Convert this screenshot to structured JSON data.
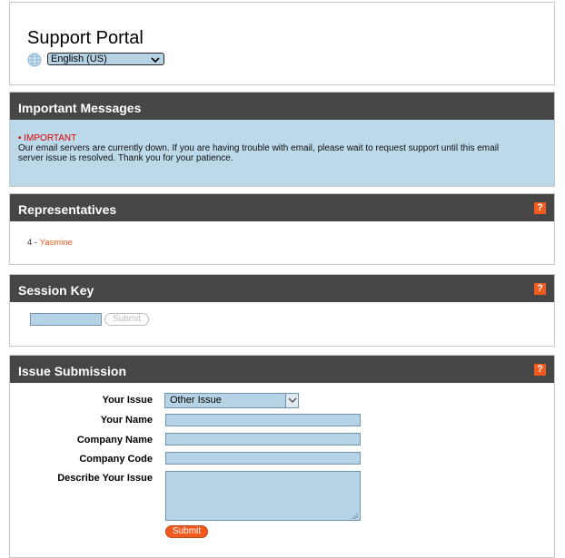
{
  "portal": {
    "title": "Support Portal",
    "language": "English (US)"
  },
  "messages": {
    "header": "Important Messages",
    "label": "IMPORTANT",
    "text": "Our email servers are currently down. If you are having trouble with email, please wait to request support until this email server issue is resolved. Thank you for your patience."
  },
  "representatives": {
    "header": "Representatives",
    "help": "?",
    "items": [
      {
        "prefix": "4 - ",
        "name": "Yasmine"
      }
    ]
  },
  "session_key": {
    "header": "Session Key",
    "help": "?",
    "submit_label": "Submit"
  },
  "issue": {
    "header": "Issue Submission",
    "help": "?",
    "labels": {
      "issue": "Your Issue",
      "name": "Your Name",
      "company": "Company Name",
      "code": "Company Code",
      "describe": "Describe Your Issue"
    },
    "issue_value": "Other Issue",
    "submit_label": "Submit"
  },
  "colors": {
    "accent": "#f25a1e",
    "header_bg": "#464646",
    "field_bg": "#b6d3e6",
    "message_bg": "#bcd9ea"
  }
}
